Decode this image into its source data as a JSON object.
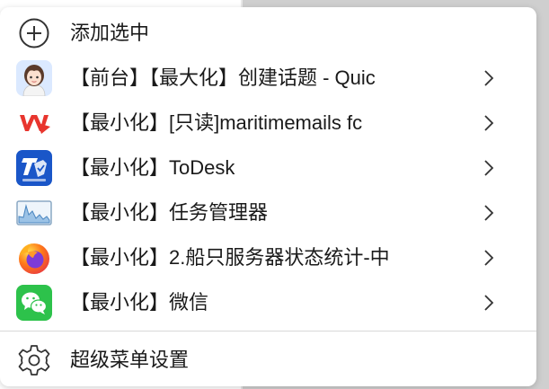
{
  "menu": {
    "top_item": {
      "label": "添加选中",
      "icon": "plus-circle-icon"
    },
    "windows": [
      {
        "label": "【前台】【最大化】创建话题 - Quic",
        "icon": "avatar-girl-icon"
      },
      {
        "label": "【最小化】[只读]maritimemails  fc",
        "icon": "wps-office-icon"
      },
      {
        "label": "【最小化】ToDesk",
        "icon": "todesk-icon"
      },
      {
        "label": "【最小化】任务管理器",
        "icon": "task-manager-icon"
      },
      {
        "label": "【最小化】2.船只服务器状态统计-中",
        "icon": "firefox-icon"
      },
      {
        "label": "【最小化】微信",
        "icon": "wechat-icon"
      }
    ],
    "settings_item": {
      "label": "超级菜单设置",
      "icon": "gear-icon"
    }
  },
  "colors": {
    "wps_red": "#e8352e",
    "todesk_blue": "#1a56c8",
    "wechat_green": "#2dc24b",
    "firefox_orange": "#ff7a18",
    "firefox_purple": "#7d3bd8"
  }
}
